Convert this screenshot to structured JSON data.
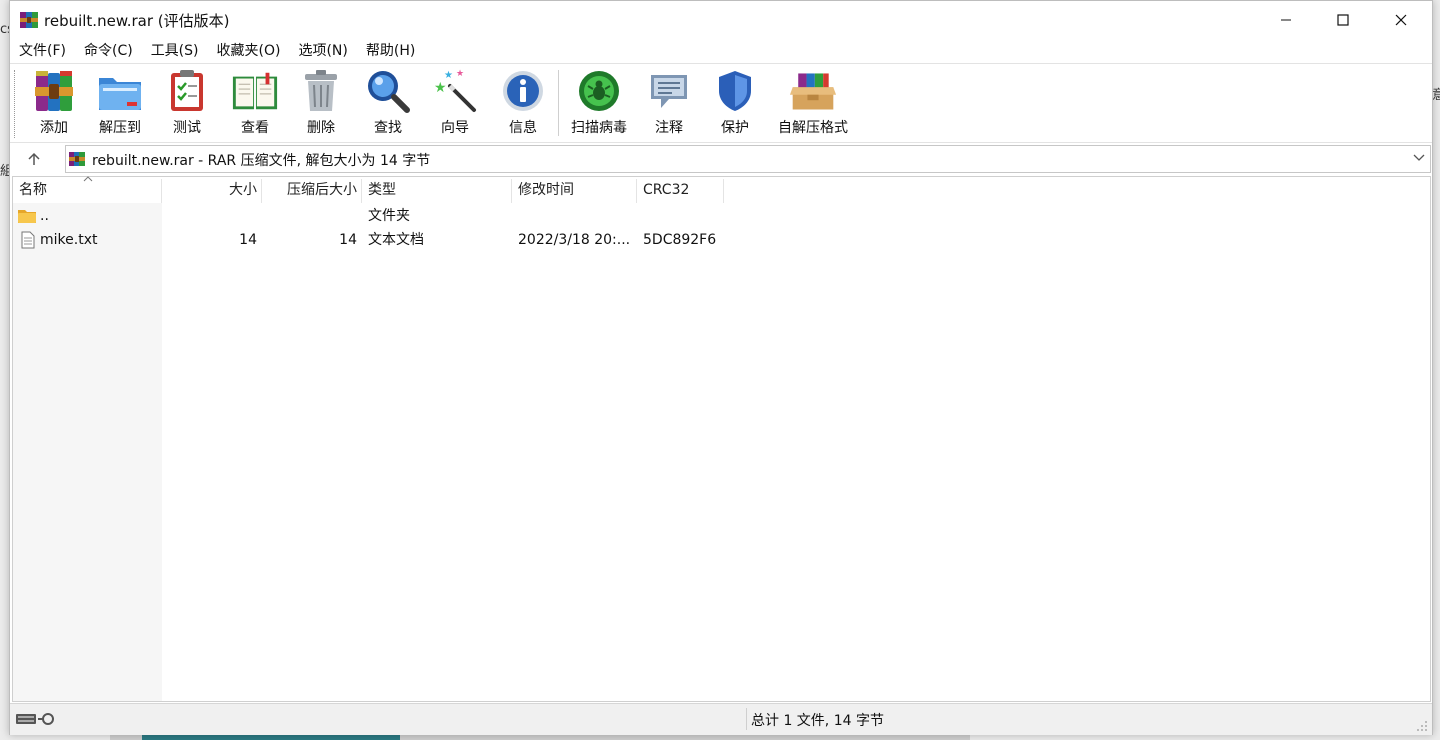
{
  "desktop": {
    "fragment_left_top": "cs",
    "fragment_left_mid": "組",
    "fragment_right": "意"
  },
  "window": {
    "title": "rebuilt.new.rar (评估版本)",
    "minimize_glyph": "—",
    "maximize_glyph": "☐",
    "close_glyph": "✕"
  },
  "menu": {
    "items": [
      "文件(F)",
      "命令(C)",
      "工具(S)",
      "收藏夹(O)",
      "选项(N)",
      "帮助(H)"
    ]
  },
  "toolbar": {
    "buttons": [
      {
        "label": "添加",
        "icon": "add-archive-icon"
      },
      {
        "label": "解压到",
        "icon": "extract-folder-icon"
      },
      {
        "label": "测试",
        "icon": "test-clipboard-icon"
      },
      {
        "label": "查看",
        "icon": "view-book-icon"
      },
      {
        "label": "删除",
        "icon": "trash-icon"
      },
      {
        "label": "查找",
        "icon": "magnifier-icon"
      },
      {
        "label": "向导",
        "icon": "wizard-wand-icon"
      },
      {
        "label": "信息",
        "icon": "info-icon"
      },
      {
        "label": "扫描病毒",
        "icon": "virus-scan-icon"
      },
      {
        "label": "注释",
        "icon": "comment-icon"
      },
      {
        "label": "保护",
        "icon": "shield-icon"
      },
      {
        "label": "自解压格式",
        "icon": "sfx-box-icon"
      }
    ]
  },
  "address": {
    "text": "rebuilt.new.rar - RAR 压缩文件, 解包大小为 14 字节"
  },
  "columns": {
    "name": "名称",
    "size": "大小",
    "packed": "压缩后大小",
    "type": "类型",
    "modified": "修改时间",
    "crc": "CRC32"
  },
  "rows": [
    {
      "name": "..",
      "size": "",
      "packed": "",
      "type": "文件夹",
      "modified": "",
      "crc": "",
      "icon": "folder-icon"
    },
    {
      "name": "mike.txt",
      "size": "14",
      "packed": "14",
      "type": "文本文档",
      "modified": "2022/3/18 20:...",
      "crc": "5DC892F6",
      "icon": "text-file-icon"
    }
  ],
  "status": {
    "summary": "总计 1 文件, 14 字节"
  },
  "colors": {
    "window_bg": "#ffffff",
    "status_bg": "#f0f0f0",
    "name_column_bg": "#f6f6f6"
  }
}
